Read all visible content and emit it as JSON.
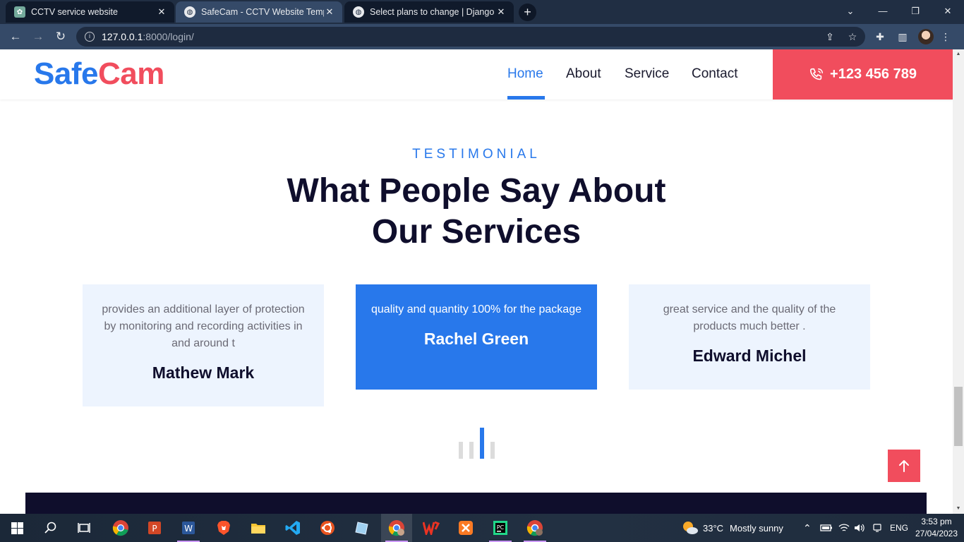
{
  "browser": {
    "tabs": [
      {
        "title": "CCTV service website"
      },
      {
        "title": "SafeCam - CCTV Website Templa"
      },
      {
        "title": "Select plans to change | Django s"
      }
    ],
    "url_host": "127.0.0.1",
    "url_path": ":8000/login/"
  },
  "site": {
    "brand_part1": "Safe",
    "brand_part2": "Cam",
    "menu": [
      "Home",
      "About",
      "Service",
      "Contact"
    ],
    "phone": "+123 456 789",
    "colors": {
      "primary": "#2878eb",
      "accent": "#f14d5d",
      "dark": "#0f0e2c",
      "card_bg": "#edf4fe"
    }
  },
  "testimonial": {
    "eyebrow": "TESTIMONIAL",
    "heading_line1": "What People Say About",
    "heading_line2": "Our Services",
    "cards": [
      {
        "quote": "provides an additional layer of protection by monitoring and recording activities in and around t",
        "name": "Mathew Mark"
      },
      {
        "quote": "quality and quantity 100% for the package",
        "name": "Rachel Green"
      },
      {
        "quote": "great service and the quality of the products much better .",
        "name": "Edward Michel"
      }
    ]
  },
  "taskbar": {
    "weather_temp": "33°C",
    "weather_text": "Mostly sunny",
    "language": "ENG",
    "time": "3:53 pm",
    "date": "27/04/2023"
  }
}
